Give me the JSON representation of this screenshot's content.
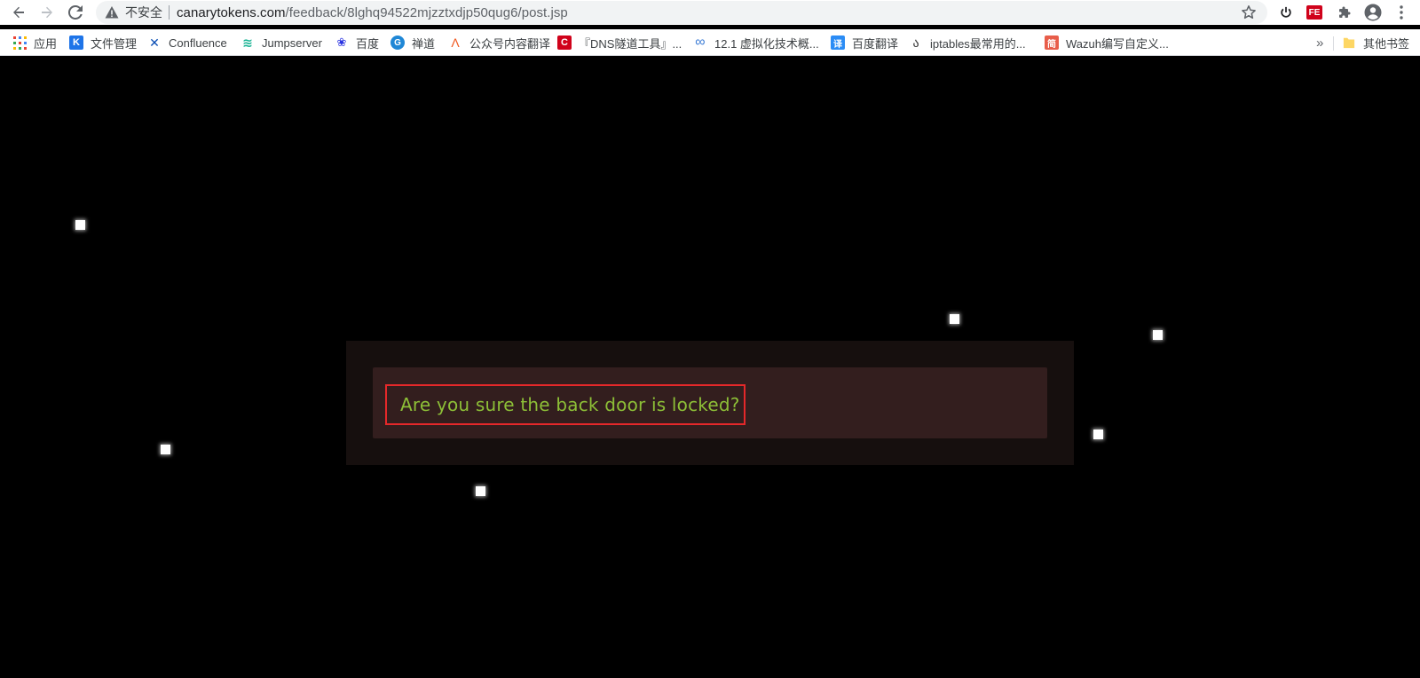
{
  "browser": {
    "security_label": "不安全",
    "url_host": "canarytokens.com",
    "url_path": "/feedback/8lghq94522mjzztxdjp50qug6/post.jsp",
    "icons": {
      "back": "arrow-left-icon",
      "forward": "arrow-right-icon",
      "reload": "reload-icon",
      "warning": "warning-triangle-icon",
      "bookmark_star": "star-icon",
      "power": "power-icon",
      "extension_fe": "fe-extension-icon",
      "extensions": "puzzle-icon",
      "profile": "profile-icon",
      "menu": "more-vertical-icon"
    },
    "extension_fe_text": "FE"
  },
  "bookmarks": {
    "items": [
      {
        "label": "应用",
        "icon": "apps-grid-icon"
      },
      {
        "label": "文件管理",
        "icon": "k-logo-icon",
        "glyph": "K"
      },
      {
        "label": "Confluence",
        "icon": "confluence-icon",
        "glyph": "✕"
      },
      {
        "label": "Jumpserver",
        "icon": "jumpserver-icon",
        "glyph": "≋"
      },
      {
        "label": "百度",
        "icon": "baidu-paw-icon",
        "glyph": "❀"
      },
      {
        "label": "禅道",
        "icon": "zentao-icon",
        "glyph": "G"
      },
      {
        "label": "公众号内容翻译",
        "icon": "a-logo-icon",
        "glyph": "Λ"
      },
      {
        "label": "『DNS隧道工具』...",
        "icon": "c-red-logo-icon",
        "glyph": "C"
      },
      {
        "label": "12.1 虚拟化技术概...",
        "icon": "link-infinity-icon",
        "glyph": "∞"
      },
      {
        "label": "百度翻译",
        "icon": "translate-icon",
        "glyph": "译"
      },
      {
        "label": "iptables最常用的...",
        "icon": "script-logo-icon",
        "glyph": "ა"
      },
      {
        "label": "Wazuh编写自定义...",
        "icon": "jian-logo-icon",
        "glyph": "简"
      }
    ],
    "overflow": "»",
    "other_bookmarks": "其他书签"
  },
  "content": {
    "message": "Are you sure the back door is locked?"
  },
  "colors": {
    "background": "#000000",
    "panel_outer": "#160f0e",
    "panel_inner": "#331e1e",
    "message_border": "#e5282a",
    "message_text": "#8dbf37"
  }
}
